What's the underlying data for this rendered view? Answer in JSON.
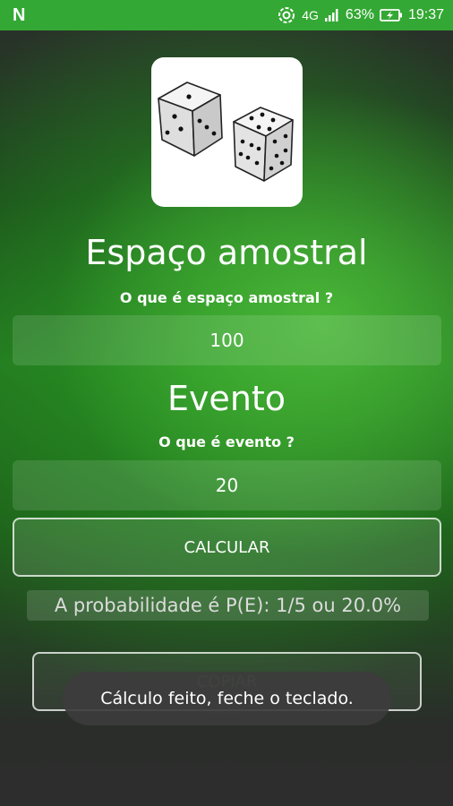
{
  "status_bar": {
    "logo": "N",
    "network": "4G",
    "battery_percent": "63%",
    "time": "19:37",
    "icons": [
      "notification-n-icon",
      "sync-icon",
      "signal-icon",
      "battery-charging-icon"
    ]
  },
  "header": {
    "image": "dice-image"
  },
  "sample_space": {
    "title": "Espaço amostral",
    "question": "O que é espaço amostral ?",
    "value": "100"
  },
  "event": {
    "title": "Evento",
    "question": "O que é evento ?",
    "value": "20"
  },
  "actions": {
    "calculate_label": "CALCULAR",
    "copy_label": "COPIAR"
  },
  "result": {
    "text": "A probabilidade é P(E): 1/5 ou 20.0%"
  },
  "toast": {
    "message": "Cálculo feito, feche o teclado."
  },
  "colors": {
    "status_bar": "#34a834",
    "accent_green": "#2e9a2a"
  }
}
